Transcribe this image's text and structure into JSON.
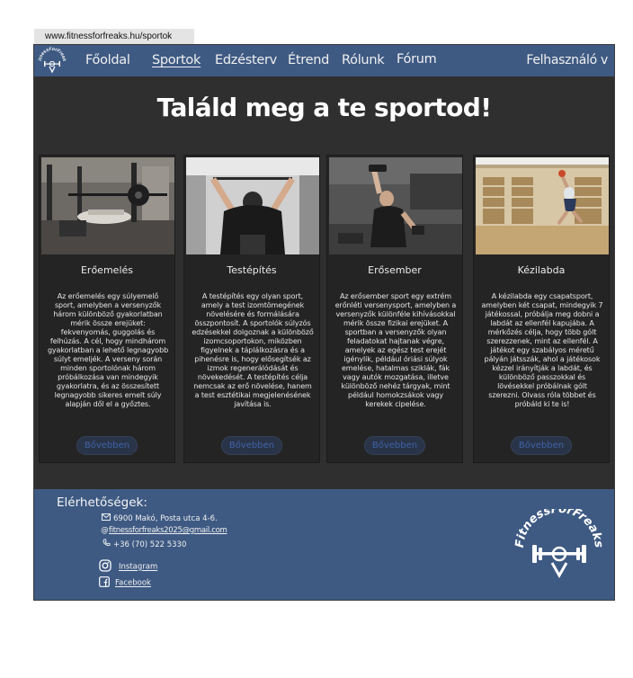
{
  "browser": {
    "url": "www.fitnessforfreaks.hu/sportok"
  },
  "brand": {
    "logo_text": "FitnessForFreaks"
  },
  "nav": {
    "items": [
      "Főoldal",
      "Sportok",
      "Edzésterv",
      "Étrend",
      "Rólunk",
      "Fórum"
    ],
    "active": "Sportok",
    "user_label": "Felhasználó v"
  },
  "hero": {
    "title": "Találd meg a te sportod!"
  },
  "cards": [
    {
      "title": "Erőemelés",
      "text": "Az erőemelés egy súlyemelő sport, amelyben a versenyzők három különböző gyakorlatban mérik össze erejüket: fekvenyomás, guggolás és felhúzás. A cél, hogy mindhárom gyakorlatban a lehető legnagyobb súlyt emeljék. A verseny során minden sportolónak három próbálkozása van mindegyik gyakorlatra, és az összesített legnagyobb sikeres emelt súly alapján dől el a győztes.",
      "button": "Bővebben",
      "image_icon": "bench-press-photo"
    },
    {
      "title": "Testépítés",
      "text": "A testépítés egy olyan sport, amely a test izomtömegének növelésére és formálására összpontosít. A sportolók súlyzós edzésekkel dolgoznak a különböző izomcsoportokon, miközben figyelnek a táplálkozásra és a pihenésre is, hogy elősegítsék az izmok regenerálódását és növekedését. A testépítés célja nemcsak az erő növelése, hanem a test esztétikai megjelenésének javítása is.",
      "button": "Bővebben",
      "image_icon": "cable-pulldown-photo"
    },
    {
      "title": "Erősember",
      "text": "Az erősember sport egy extrém erőnléti versenysport, amelyben a versenyzők különféle kihívásokkal mérik össze fizikai erejüket. A sportban a versenyzők olyan feladatokat hajtanak végre, amelyek az egész test erejét igénylik, például óriási súlyok emelése, hatalmas sziklák, fák vagy autók mozgatása, illetve különböző nehéz tárgyak, mint például homokzsákok vagy kerekek cipelése.",
      "button": "Bővebben",
      "image_icon": "dumbbell-lift-photo"
    },
    {
      "title": "Kézilabda",
      "text": "A kézilabda egy csapatsport, amelyben két csapat, mindegyik 7 játékossal, próbálja meg dobni a labdát az ellenfél kapujába. A mérkőzés célja, hogy több gólt szerezzenek, mint az ellenfél. A játékot egy szabályos méretű pályán játsszák, ahol a játékosok kézzel irányítják a labdát, és különböző passzokkal és lövésekkel próbálnak gólt szerezni. Olvass róla többet és próbáld ki te is!",
      "button": "Bővebben",
      "image_icon": "handball-jump-photo"
    }
  ],
  "footer": {
    "heading": "Elérhetőségek:",
    "address": "6900 Makó, Posta utca 4-6.",
    "email": "fitnessforfreaks2025@gmail.com",
    "phone": "+36 (70) 522 5330",
    "instagram": "Instagram",
    "facebook": "Facebook"
  },
  "colors": {
    "nav_bg": "#3e5a83",
    "page_bg": "#2f2f2f",
    "card_bg": "#242424",
    "button_text": "#3f63a8"
  }
}
